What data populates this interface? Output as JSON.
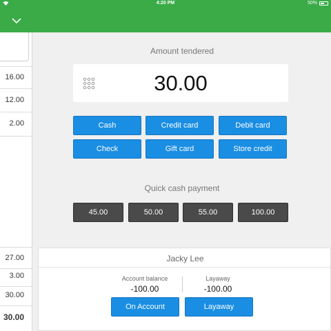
{
  "status_bar": {
    "time": "4:20 PM",
    "battery": "50%"
  },
  "icons": {
    "chevron": "chevron-down-icon",
    "keypad": "keypad-icon",
    "wifi": "wifi-icon",
    "battery": "battery-icon"
  },
  "left_panel": {
    "top_values": [
      "16.00",
      "12.00",
      "2.00"
    ],
    "bottom_values": [
      "27.00",
      "3.00",
      "30.00",
      "30.00"
    ]
  },
  "tender": {
    "title": "Amount tendered",
    "amount": "30.00"
  },
  "payment_methods": [
    "Cash",
    "Credit card",
    "Debit card",
    "Check",
    "Gift card",
    "Store credit"
  ],
  "quick_cash": {
    "title": "Quick cash payment",
    "amounts": [
      "45.00",
      "50.00",
      "55.00",
      "100.00"
    ]
  },
  "customer": {
    "name": "Jacky Lee",
    "account_balance_label": "Account balance",
    "account_balance": "-100.00",
    "layaway_label": "Layaway",
    "layaway": "-100.00",
    "on_account_button": "On Account",
    "layaway_button": "Layaway"
  },
  "colors": {
    "header_green": "#3aab47",
    "payment_blue": "#1a8ee3",
    "quick_dark": "#4a4a4a",
    "background": "#f0f0f0"
  }
}
